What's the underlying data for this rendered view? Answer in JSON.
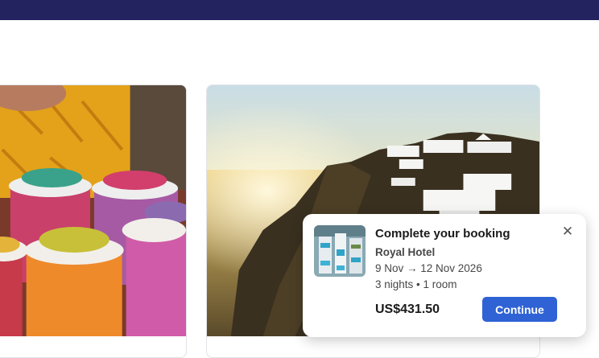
{
  "popup": {
    "title": "Complete your booking",
    "hotel_name": "Royal Hotel",
    "dates": "9 Nov → 12 Nov 2026",
    "stay_summary": "3 nights • 1 room",
    "price": "US$431.50",
    "continue_label": "Continue",
    "close_glyph": "✕"
  },
  "icons": {
    "close": "close-icon"
  },
  "colors": {
    "topbar": "#23235f",
    "primary_button": "#2f62d4"
  }
}
